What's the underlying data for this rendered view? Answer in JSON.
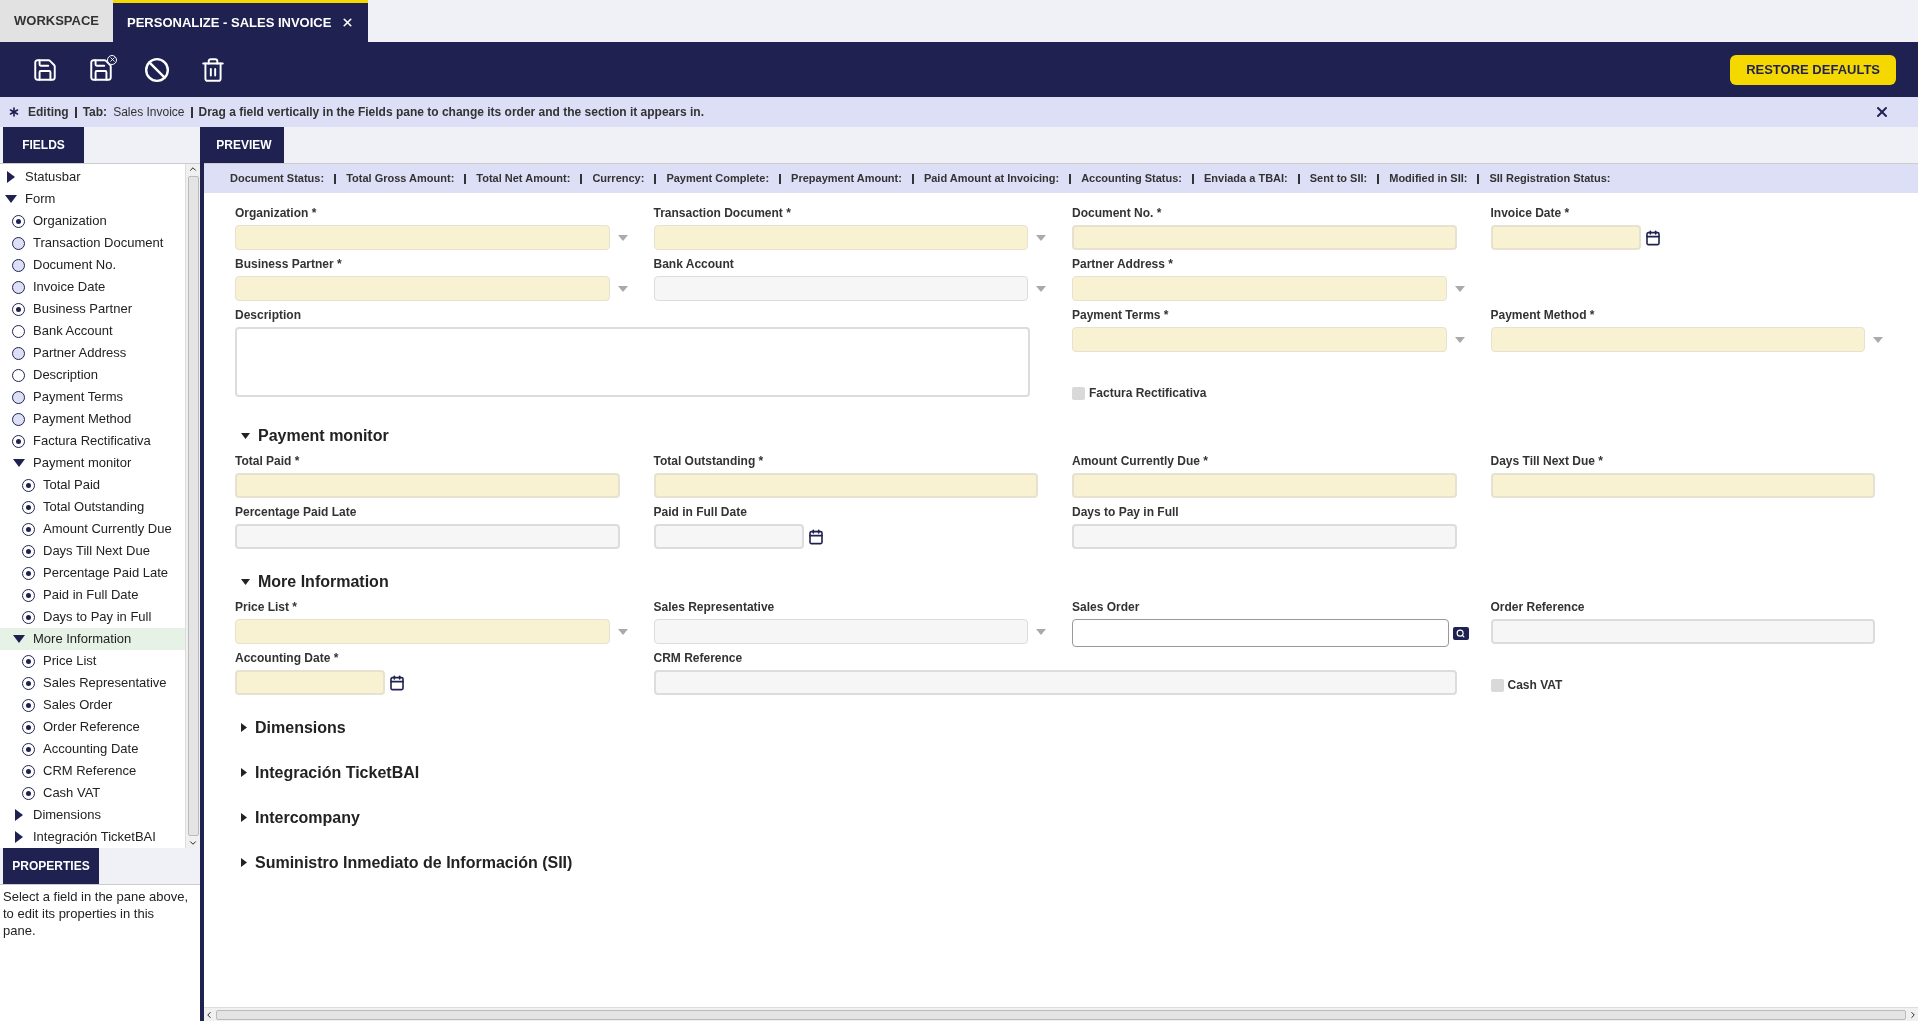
{
  "tabs": [
    {
      "label": "WORKSPACE",
      "selected": false
    },
    {
      "label": "PERSONALIZE - SALES INVOICE",
      "selected": true
    }
  ],
  "toolbar": {
    "restore_button": "RESTORE DEFAULTS"
  },
  "info_bar": {
    "mode": "Editing",
    "tab_label": "Tab:",
    "tab_name": "Sales Invoice",
    "hint": "Drag a field vertically in the Fields pane to change its order and the section it appears in."
  },
  "fields_pane": {
    "title": "FIELDS",
    "tree": [
      {
        "label": "Statusbar",
        "kind": "folder",
        "expanded": false,
        "selected": false
      },
      {
        "label": "Form",
        "kind": "folder",
        "expanded": true,
        "selected": false,
        "children": [
          {
            "label": "Organization",
            "kind": "dotted",
            "selected": false
          },
          {
            "label": "Transaction Document",
            "kind": "shaded",
            "selected": false
          },
          {
            "label": "Document No.",
            "kind": "shaded",
            "selected": false
          },
          {
            "label": "Invoice Date",
            "kind": "shaded",
            "selected": false
          },
          {
            "label": "Business Partner",
            "kind": "dotted",
            "selected": false
          },
          {
            "label": "Bank Account",
            "kind": "hollow",
            "selected": false
          },
          {
            "label": "Partner Address",
            "kind": "shaded",
            "selected": false
          },
          {
            "label": "Description",
            "kind": "hollow",
            "selected": false
          },
          {
            "label": "Payment Terms",
            "kind": "shaded",
            "selected": false
          },
          {
            "label": "Payment Method",
            "kind": "shaded",
            "selected": false
          },
          {
            "label": "Factura Rectificativa",
            "kind": "dotted",
            "selected": false
          },
          {
            "label": "Payment monitor",
            "kind": "folder",
            "expanded": true,
            "selected": false,
            "children": [
              {
                "label": "Total Paid",
                "kind": "dotted",
                "selected": false
              },
              {
                "label": "Total Outstanding",
                "kind": "dotted",
                "selected": false
              },
              {
                "label": "Amount Currently Due",
                "kind": "dotted",
                "selected": false
              },
              {
                "label": "Days Till Next Due",
                "kind": "dotted",
                "selected": false
              },
              {
                "label": "Percentage Paid Late",
                "kind": "dotted",
                "selected": false
              },
              {
                "label": "Paid in Full Date",
                "kind": "dotted",
                "selected": false
              },
              {
                "label": "Days to Pay in Full",
                "kind": "dotted",
                "selected": false
              }
            ]
          },
          {
            "label": "More Information",
            "kind": "folder",
            "expanded": true,
            "selected": true,
            "children": [
              {
                "label": "Price List",
                "kind": "dotted",
                "selected": false
              },
              {
                "label": "Sales Representative",
                "kind": "dotted",
                "selected": false
              },
              {
                "label": "Sales Order",
                "kind": "dotted",
                "selected": false
              },
              {
                "label": "Order Reference",
                "kind": "dotted",
                "selected": false
              },
              {
                "label": "Accounting Date",
                "kind": "dotted",
                "selected": false
              },
              {
                "label": "CRM Reference",
                "kind": "dotted",
                "selected": false
              },
              {
                "label": "Cash VAT",
                "kind": "dotted",
                "selected": false
              }
            ]
          },
          {
            "label": "Dimensions",
            "kind": "folder",
            "expanded": false,
            "selected": false
          },
          {
            "label": "Integración TicketBAI",
            "kind": "folder",
            "expanded": false,
            "selected": false
          }
        ]
      }
    ]
  },
  "properties_pane": {
    "title": "PROPERTIES",
    "text": "Select a field in the pane above, to edit its properties in this pane."
  },
  "preview": {
    "title": "PREVIEW",
    "status_bar": [
      "Document Status:",
      "Total Gross Amount:",
      "Total Net Amount:",
      "Currency:",
      "Payment Complete:",
      "Prepayment Amount:",
      "Paid Amount at Invoicing:",
      "Accounting Status:",
      "Enviada a TBAI:",
      "Sent to SII:",
      "Modified in SII:",
      "SII Registration Status:"
    ],
    "main_fields": [
      {
        "label": "Organization *",
        "kind": "combo",
        "required": true
      },
      {
        "label": "Transaction Document *",
        "kind": "combo",
        "required": true
      },
      {
        "label": "Document No. *",
        "kind": "text",
        "required": true
      },
      {
        "label": "Invoice Date *",
        "kind": "date",
        "required": true
      },
      {
        "label": "Business Partner *",
        "kind": "combo",
        "required": true
      },
      {
        "label": "Bank Account",
        "kind": "combo",
        "required": false
      },
      {
        "label": "Partner Address *",
        "kind": "combo",
        "required": true
      },
      {
        "label": "Description",
        "kind": "textarea",
        "required": false
      },
      {
        "label": "Payment Terms *",
        "kind": "combo",
        "required": true
      },
      {
        "label": "Payment Method *",
        "kind": "combo",
        "required": true
      },
      {
        "label": "Factura Rectificativa",
        "kind": "checkbox",
        "checked": false
      }
    ],
    "sections": [
      {
        "title": "Payment monitor",
        "expanded": true,
        "fields": [
          {
            "label": "Total Paid *",
            "kind": "text",
            "required": true
          },
          {
            "label": "Total Outstanding *",
            "kind": "text",
            "required": true
          },
          {
            "label": "Amount Currently Due *",
            "kind": "text",
            "required": true
          },
          {
            "label": "Days Till Next Due *",
            "kind": "text",
            "required": true
          },
          {
            "label": "Percentage Paid Late",
            "kind": "text",
            "required": false
          },
          {
            "label": "Paid in Full Date",
            "kind": "date",
            "required": false
          },
          {
            "label": "Days to Pay in Full",
            "kind": "text",
            "required": false
          }
        ]
      },
      {
        "title": "More Information",
        "expanded": true,
        "fields": [
          {
            "label": "Price List *",
            "kind": "combo",
            "required": true
          },
          {
            "label": "Sales Representative",
            "kind": "combo",
            "required": false
          },
          {
            "label": "Sales Order",
            "kind": "search",
            "required": false
          },
          {
            "label": "Order Reference",
            "kind": "text",
            "required": false
          },
          {
            "label": "Accounting Date *",
            "kind": "date",
            "required": true
          },
          {
            "label": "CRM Reference",
            "kind": "wide_text",
            "required": false
          },
          {
            "label": "Cash VAT",
            "kind": "checkbox",
            "checked": false
          }
        ]
      },
      {
        "title": "Dimensions",
        "expanded": false
      },
      {
        "title": "Integración TicketBAI",
        "expanded": false
      },
      {
        "title": "Intercompany",
        "expanded": false
      },
      {
        "title": "Suministro Inmediato de Información (SII)",
        "expanded": false
      }
    ]
  }
}
